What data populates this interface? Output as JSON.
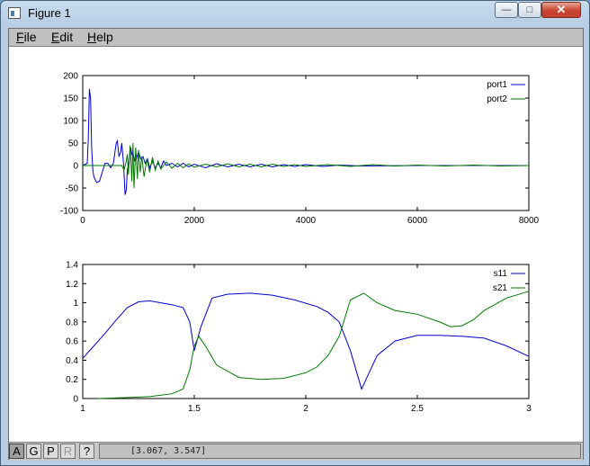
{
  "window": {
    "title": "Figure 1",
    "controls": {
      "minimize": "—",
      "maximize": "□",
      "close": "✕"
    }
  },
  "menu": {
    "items": [
      {
        "underline": "F",
        "rest": "ile"
      },
      {
        "underline": "E",
        "rest": "dit"
      },
      {
        "underline": "H",
        "rest": "elp"
      }
    ]
  },
  "colors": {
    "series1": "#0000cc",
    "series2": "#007700"
  },
  "chart_data": [
    {
      "type": "line",
      "xlim": [
        0,
        8000
      ],
      "ylim": [
        -100,
        200
      ],
      "xticks": [
        0,
        2000,
        4000,
        6000,
        8000
      ],
      "yticks": [
        -100,
        -50,
        0,
        50,
        100,
        150,
        200
      ],
      "legend_position": "top-right",
      "series": [
        {
          "name": "port1",
          "x": [
            0,
            80,
            100,
            120,
            140,
            160,
            180,
            200,
            250,
            300,
            350,
            400,
            450,
            500,
            550,
            600,
            620,
            650,
            680,
            700,
            730,
            760,
            780,
            800,
            830,
            860,
            880,
            900,
            930,
            960,
            1000,
            1040,
            1080,
            1120,
            1160,
            1200,
            1250,
            1300,
            1350,
            1400,
            1450,
            1500,
            1600,
            1700,
            1800,
            1900,
            2000,
            2200,
            2400,
            2600,
            2800,
            3000,
            3200,
            3400,
            3600,
            3800,
            4000,
            4300,
            4600,
            5000,
            6000,
            7000,
            8000
          ],
          "y": [
            0,
            5,
            60,
            170,
            150,
            40,
            -10,
            -25,
            -38,
            -35,
            -15,
            5,
            5,
            -5,
            5,
            50,
            55,
            20,
            30,
            50,
            5,
            -65,
            -55,
            -10,
            10,
            40,
            25,
            30,
            10,
            15,
            30,
            15,
            20,
            5,
            15,
            -5,
            10,
            -5,
            5,
            -5,
            10,
            0,
            5,
            -3,
            5,
            -3,
            3,
            -5,
            4,
            -3,
            3,
            -3,
            3,
            -3,
            2,
            -2,
            2,
            -2,
            1,
            -1,
            0,
            0,
            0
          ]
        },
        {
          "name": "port2",
          "x": [
            0,
            700,
            740,
            780,
            800,
            820,
            850,
            880,
            900,
            920,
            950,
            980,
            1000,
            1030,
            1060,
            1100,
            1150,
            1200,
            1250,
            1300,
            1350,
            1400,
            1500,
            1600,
            1700,
            1800,
            1900,
            2000,
            2200,
            2400,
            2600,
            2800,
            3000,
            3200,
            3400,
            3600,
            3800,
            4000,
            4400,
            4800,
            5200,
            5600,
            6000,
            6500,
            7000,
            7500,
            8000
          ],
          "y": [
            0,
            0,
            -10,
            10,
            25,
            -20,
            45,
            -35,
            50,
            -50,
            40,
            -30,
            35,
            -15,
            20,
            -25,
            15,
            -15,
            18,
            -10,
            10,
            -8,
            8,
            -6,
            5,
            -5,
            4,
            -4,
            3,
            -3,
            4,
            -3,
            3,
            -3,
            3,
            -2,
            2,
            -2,
            2,
            -2,
            2,
            -1,
            1,
            -1,
            1,
            -1,
            0
          ]
        }
      ]
    },
    {
      "type": "line",
      "xlim": [
        1,
        3
      ],
      "ylim": [
        0,
        1.4
      ],
      "xticks": [
        1,
        1.5,
        2,
        2.5,
        3
      ],
      "xtick_labels": [
        "1",
        "1.5",
        "2",
        "2.5",
        "3"
      ],
      "yticks": [
        0,
        0.2,
        0.4,
        0.6,
        0.8,
        1.0,
        1.2,
        1.4
      ],
      "ytick_labels": [
        "0",
        "0.2",
        "0.4",
        "0.6",
        "0.8",
        "1",
        "1.2",
        "1.4"
      ],
      "legend_position": "top-right",
      "series": [
        {
          "name": "s11",
          "x": [
            1.0,
            1.05,
            1.1,
            1.15,
            1.2,
            1.25,
            1.3,
            1.35,
            1.4,
            1.45,
            1.48,
            1.5,
            1.53,
            1.58,
            1.65,
            1.75,
            1.85,
            1.95,
            2.05,
            2.1,
            2.15,
            2.2,
            2.25,
            2.27,
            2.32,
            2.4,
            2.5,
            2.6,
            2.7,
            2.8,
            2.9,
            3.0
          ],
          "y": [
            0.42,
            0.55,
            0.68,
            0.82,
            0.95,
            1.01,
            1.02,
            1.0,
            0.98,
            0.95,
            0.8,
            0.5,
            0.75,
            1.05,
            1.09,
            1.1,
            1.08,
            1.03,
            0.96,
            0.9,
            0.8,
            0.5,
            0.1,
            0.2,
            0.45,
            0.6,
            0.66,
            0.66,
            0.65,
            0.63,
            0.55,
            0.44
          ]
        },
        {
          "name": "s21",
          "x": [
            1.07,
            1.2,
            1.3,
            1.4,
            1.45,
            1.48,
            1.5,
            1.52,
            1.55,
            1.6,
            1.7,
            1.8,
            1.9,
            2.0,
            2.05,
            2.1,
            2.15,
            2.2,
            2.26,
            2.32,
            2.4,
            2.5,
            2.6,
            2.65,
            2.7,
            2.75,
            2.8,
            2.9,
            3.0
          ],
          "y": [
            0.0,
            0.01,
            0.02,
            0.05,
            0.1,
            0.3,
            0.55,
            0.65,
            0.55,
            0.35,
            0.22,
            0.2,
            0.21,
            0.27,
            0.33,
            0.45,
            0.65,
            1.03,
            1.1,
            1.0,
            0.92,
            0.88,
            0.8,
            0.75,
            0.76,
            0.82,
            0.92,
            1.05,
            1.12
          ]
        }
      ]
    }
  ],
  "statusbar": {
    "buttons": [
      {
        "label": "A",
        "state": "active"
      },
      {
        "label": "G",
        "state": "normal"
      },
      {
        "label": "P",
        "state": "normal"
      },
      {
        "label": "R",
        "state": "disabled"
      },
      {
        "label": "?",
        "state": "normal"
      }
    ],
    "coordinates": "[3.067, 3.547]"
  }
}
